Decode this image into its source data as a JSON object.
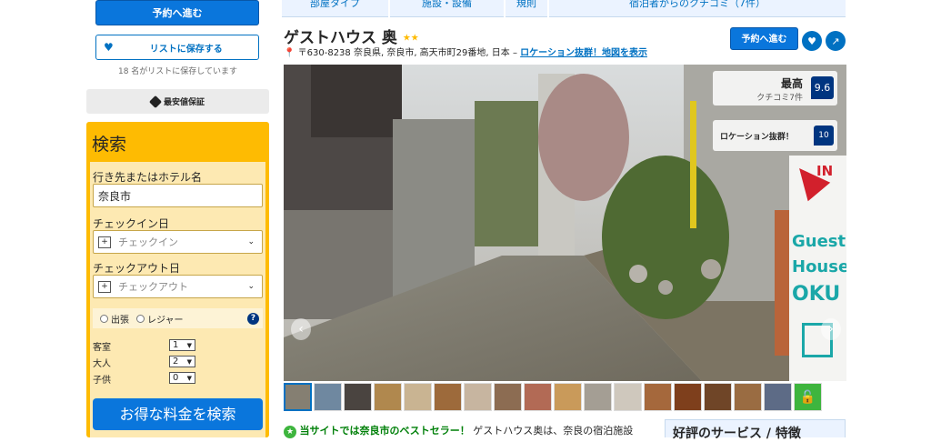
{
  "sidebar": {
    "reserve_button": "予約へ進む",
    "save_list_button": "リストに保存する",
    "saved_count_text": "18 名がリストに保存しています",
    "best_price_label": "最安値保証",
    "search": {
      "title": "検索",
      "destination_label": "行き先またはホテル名",
      "destination_value": "奈良市",
      "checkin_label": "チェックイン日",
      "checkin_placeholder": "チェックイン",
      "checkout_label": "チェックアウト日",
      "checkout_placeholder": "チェックアウト",
      "purpose_business": "出張",
      "purpose_leisure": "レジャー",
      "rooms_label": "客室",
      "rooms_value": "1",
      "adults_label": "大人",
      "adults_value": "2",
      "children_label": "子供",
      "children_value": "0",
      "submit_button": "お得な料金を検索"
    }
  },
  "tabs": [
    {
      "label": "部屋タイプ"
    },
    {
      "label": "施設・設備"
    },
    {
      "label": "規則"
    },
    {
      "label": "宿泊者からのクチコミ（7件）"
    }
  ],
  "hotel": {
    "name": "ゲストハウス 奥",
    "stars": "★★",
    "address": "〒630-8238 奈良県, 奈良市, 高天市町29番地, 日本 –",
    "location_link": "ロケーション抜群！地図を表示",
    "reserve_button": "予約へ進む"
  },
  "score": {
    "rating_label": "最高",
    "reviews_text": "クチコミ7件",
    "value": "9.6",
    "location_label": "ロケーション抜群！",
    "location_score": "10"
  },
  "photo_sign": {
    "in_text": "IN",
    "guest_text": "Guest",
    "house_text": "House",
    "oku_text": "OKU"
  },
  "bottom": {
    "bestseller_text": "当サイトでは奈良市のベストセラー！",
    "description_text": "ゲストハウス奥は、奈良の宿泊施設",
    "services_heading": "好評のサービス / 特徴"
  },
  "colors": {
    "brand_blue": "#0071c2",
    "button_blue": "#0a76dc",
    "search_yellow": "#febb02",
    "score_navy": "#003580",
    "star_gold": "#febb02",
    "lock_green": "#3eb53e"
  }
}
